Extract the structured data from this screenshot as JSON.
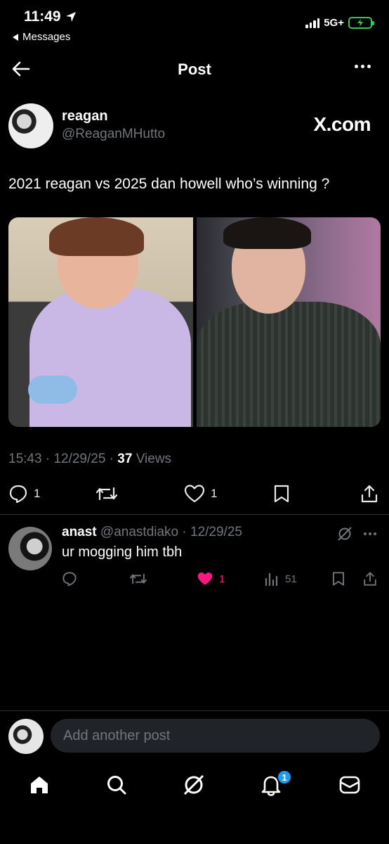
{
  "status_bar": {
    "time": "11:49",
    "back_label": "Messages",
    "network": "5G+"
  },
  "header": {
    "title": "Post"
  },
  "post": {
    "author_name": "reagan",
    "author_handle": "@ReaganMHutto",
    "source_badge": "X.com",
    "text": "2021 reagan vs 2025 dan howell who’s winning ?",
    "time": "15:43",
    "date": "12/29/25",
    "views_count": "37",
    "views_label": "Views",
    "actions": {
      "replies": "1",
      "reposts": "",
      "likes": "1"
    }
  },
  "reply": {
    "author_name": "anast",
    "author_handle": "@anastdiako",
    "date": "12/29/25",
    "text": "ur mogging him tbh",
    "likes": "1",
    "views": "51",
    "like_color": "#f91880"
  },
  "composer": {
    "placeholder": "Add another post"
  },
  "nav": {
    "items": [
      "home-icon",
      "search-icon",
      "grok-icon",
      "notifications-icon",
      "messages-icon"
    ],
    "notifications_badge": "1"
  },
  "colors": {
    "accent": "#1d9bf0",
    "muted": "#71767b",
    "battery": "#34c759"
  }
}
